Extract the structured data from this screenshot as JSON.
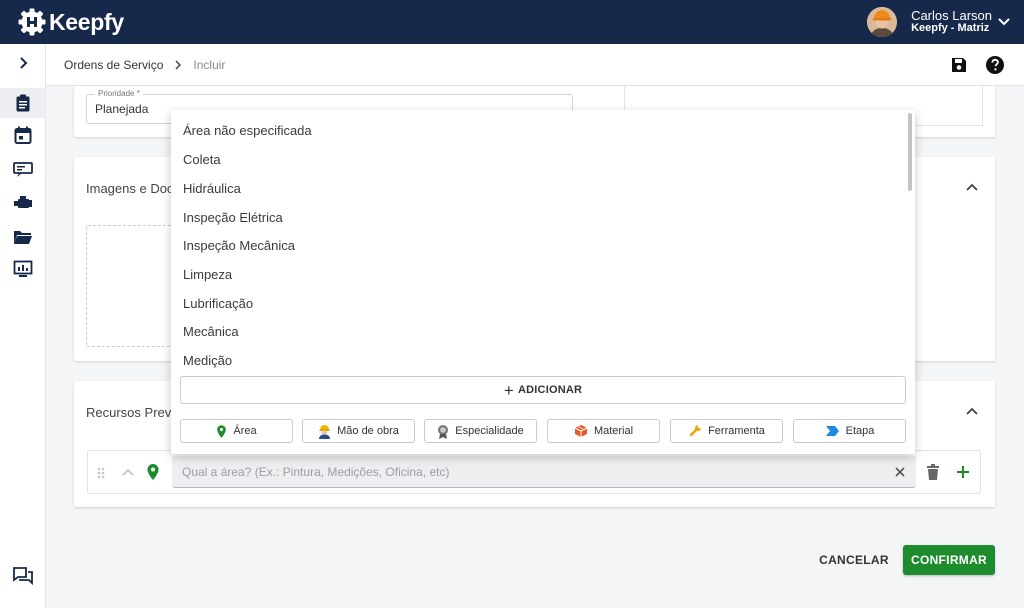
{
  "app": {
    "name": "Keepfy"
  },
  "user": {
    "name": "Carlos Larson",
    "org": "Keepfy - Matriz"
  },
  "breadcrumb": {
    "first": "Ordens de Serviço",
    "second": "Incluir"
  },
  "priority": {
    "label": "Prioridade *",
    "value": "Planejada"
  },
  "sections": {
    "images_title": "Imagens e Doc",
    "resources_title": "Recursos Prev"
  },
  "dropdown": {
    "options": [
      "Área não especificada",
      "Coleta",
      "Hidráulica",
      "Inspeção Elétrica",
      "Inspeção Mecânica",
      "Limpeza",
      "Lubrificação",
      "Mecânica",
      "Medição"
    ],
    "add_label": "ADICIONAR",
    "chips": [
      "Área",
      "Mão de obra",
      "Especialidade",
      "Material",
      "Ferramenta",
      "Etapa"
    ]
  },
  "resource_row": {
    "placeholder": "Qual a área? (Ex.: Pintura, Medições, Oficina, etc)"
  },
  "actions": {
    "cancel": "CANCELAR",
    "confirm": "CONFIRMAR"
  },
  "colors": {
    "topbar": "#17294a",
    "confirm": "#1c8c2c",
    "area_pin": "#1c8c2c"
  }
}
